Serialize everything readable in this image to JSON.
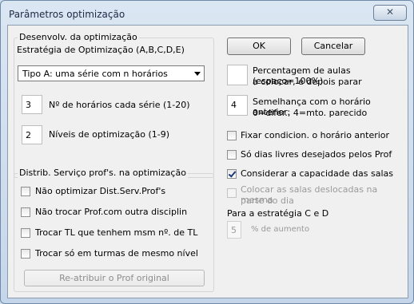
{
  "window": {
    "title": "Parâmetros optimização",
    "close_glyph": "✕"
  },
  "buttons": {
    "ok": "OK",
    "cancel": "Cancelar",
    "reassign": "Re-atribuir o Prof original"
  },
  "group_optim": {
    "legend": "Desenvolv. da optimização",
    "strategy_label": "Estratégia de Optimização (A,B,C,D,E)",
    "strategy_selected": "Tipo A: uma série com n horários",
    "num_schedules_value": "3",
    "num_schedules_label": "Nº de horários cada série (1-20)",
    "levels_value": "2",
    "levels_label": "Níveis de optimização (1-9)"
  },
  "group_distrib": {
    "legend": "Distrib. Serviço prof's. na optimização",
    "checks": [
      {
        "label": "Não optimizar Dist.Serv.Prof's",
        "checked": false
      },
      {
        "label": "Não trocar Prof.com outra disciplin",
        "checked": false
      },
      {
        "label": "Trocar TL que tenhem msm nº. de TL",
        "checked": false
      },
      {
        "label": "Trocar só em turmas de mesmo nível",
        "checked": false
      }
    ]
  },
  "right": {
    "percent_value": "",
    "percent_label": "Percentagem de aulas (espaço=100%)",
    "percent_label2": "a colocar, e depois parar",
    "similarity_value": "4",
    "similarity_label": "Semelhança com o horário anterior:",
    "similarity_label2": "0=difer., 4=mto. parecido",
    "checks": [
      {
        "label": "Fixar condicion. o horário anterior",
        "checked": false
      },
      {
        "label": "Só dias livres desejados pelos Prof",
        "checked": false
      },
      {
        "label": "Considerar a capacidade das salas",
        "checked": true
      }
    ],
    "disabled_check_line1": "Colocar as salas deslocadas na mesma",
    "disabled_check_line2": "parte do dia",
    "strategy_cd_label": "Para a estratégia C e D",
    "increase_value": "5",
    "increase_label": "% de aumento"
  }
}
